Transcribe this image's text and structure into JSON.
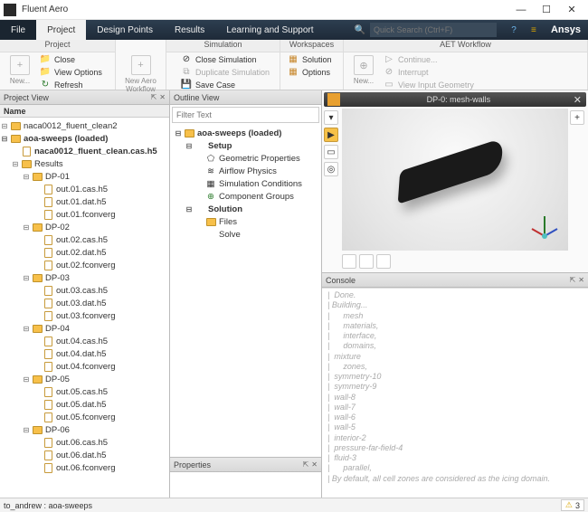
{
  "app": {
    "title": "Fluent Aero"
  },
  "menu": {
    "file": "File",
    "tabs": [
      "Project",
      "Design Points",
      "Results",
      "Learning and Support"
    ],
    "search_ph": "Quick Search (Ctrl+F)",
    "brand": "Ansys"
  },
  "ribbon": {
    "g1": {
      "title": "Project",
      "big": "New...",
      "items": [
        "Close",
        "View Options",
        "Refresh"
      ]
    },
    "g2": {
      "big": "New Aero Workflow"
    },
    "g3": {
      "title": "Simulation",
      "items": [
        "Close Simulation",
        "Duplicate Simulation",
        "Save Case"
      ]
    },
    "g4": {
      "title": "Workspaces",
      "items": [
        "Solution",
        "Options"
      ]
    },
    "g5": {
      "title": "AET Workflow",
      "big": "New...",
      "items": [
        "Continue...",
        "Interrupt",
        "View Input Geometry"
      ]
    }
  },
  "projectview": {
    "title": "Project View",
    "namecol": "Name",
    "root1": "naca0012_fluent_clean2",
    "root2": "aoa-sweeps (loaded)",
    "cas": "naca0012_fluent_clean.cas.h5",
    "results": "Results",
    "dps": [
      "DP-01",
      "DP-02",
      "DP-03",
      "DP-04",
      "DP-05",
      "DP-06"
    ],
    "dpfiles": [
      [
        "out.01.cas.h5",
        "out.01.dat.h5",
        "out.01.fconverg"
      ],
      [
        "out.02.cas.h5",
        "out.02.dat.h5",
        "out.02.fconverg"
      ],
      [
        "out.03.cas.h5",
        "out.03.dat.h5",
        "out.03.fconverg"
      ],
      [
        "out.04.cas.h5",
        "out.04.dat.h5",
        "out.04.fconverg"
      ],
      [
        "out.05.cas.h5",
        "out.05.dat.h5",
        "out.05.fconverg"
      ],
      [
        "out.06.cas.h5",
        "out.06.dat.h5",
        "out.06.fconverg"
      ]
    ]
  },
  "outline": {
    "title": "Outline View",
    "filter_ph": "Filter Text",
    "root": "aoa-sweeps (loaded)",
    "setup": "Setup",
    "setup_items": [
      "Geometric Properties",
      "Airflow Physics",
      "Simulation Conditions",
      "Component Groups"
    ],
    "solution": "Solution",
    "sol_items": [
      "Files",
      "Solve"
    ]
  },
  "properties": {
    "title": "Properties"
  },
  "viewport": {
    "title": "DP-0: mesh-walls"
  },
  "console": {
    "title": "Console",
    "lines": [
      "|  Done.",
      "| Building...",
      "|      mesh",
      "|      materials,",
      "|      interface,",
      "|      domains,",
      "|  mixture",
      "|      zones,",
      "|  symmetry-10",
      "|  symmetry-9",
      "|  wall-8",
      "|  wall-7",
      "|  wall-6",
      "|  wall-5",
      "|  interior-2",
      "|  pressure-far-field-4",
      "|  fluid-3",
      "|      parallel,",
      "| By default, all cell zones are considered as the icing domain."
    ]
  },
  "status": {
    "path": "to_andrew : aoa-sweeps",
    "warn_count": "3"
  }
}
